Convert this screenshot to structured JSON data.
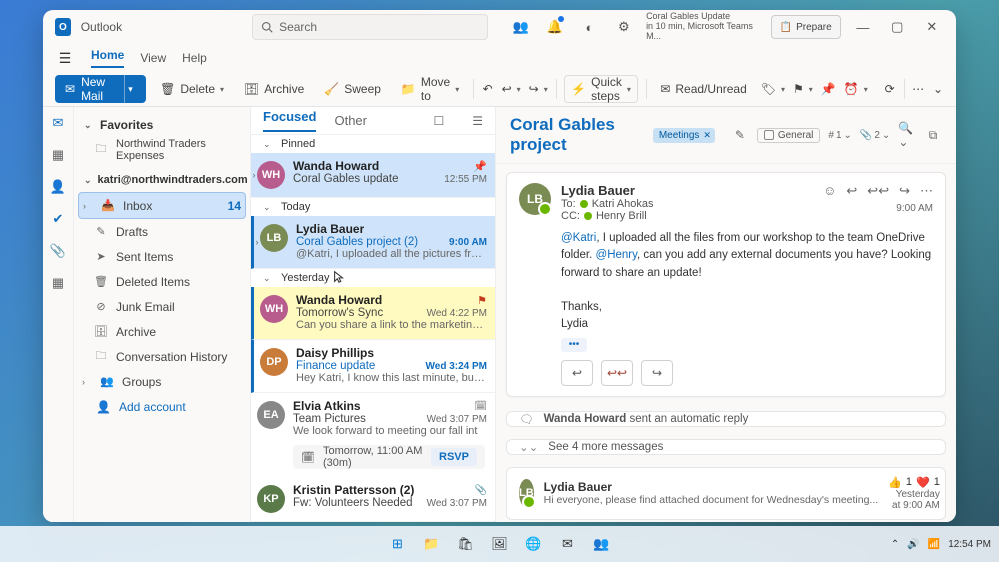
{
  "app": {
    "name": "Outlook"
  },
  "search": {
    "placeholder": "Search"
  },
  "reminder": {
    "title": "Coral Gables Update",
    "sub": "in 10 min, Microsoft Teams M..."
  },
  "prepare": {
    "label": "Prepare"
  },
  "menus": {
    "home": "Home",
    "view": "View",
    "help": "Help"
  },
  "ribbon": {
    "newmail": "New Mail",
    "delete": "Delete",
    "archive": "Archive",
    "sweep": "Sweep",
    "moveto": "Move to",
    "quicksteps": "Quick steps",
    "readunread": "Read/Unread"
  },
  "folders": {
    "favorites": "Favorites",
    "nt_expenses": "Northwind Traders Expenses",
    "account": "katri@northwindtraders.com",
    "inbox": "Inbox",
    "inbox_count": "14",
    "drafts": "Drafts",
    "sent": "Sent Items",
    "deleted": "Deleted Items",
    "junk": "Junk Email",
    "archive": "Archive",
    "convo": "Conversation History",
    "groups": "Groups",
    "addacct": "Add account"
  },
  "tabs": {
    "focused": "Focused",
    "other": "Other"
  },
  "groups": {
    "pinned": "Pinned",
    "today": "Today",
    "yesterday": "Yesterday"
  },
  "msgs": {
    "m1": {
      "sender": "Wanda Howard",
      "subject": "Coral Gables update",
      "date": "12:55 PM",
      "initials": "WH"
    },
    "m2": {
      "sender": "Lydia Bauer",
      "subject": "Coral Gables project  (2)",
      "date": "9:00 AM",
      "preview": "@Katri, I uploaded all the pictures from o",
      "initials": "LB"
    },
    "m3": {
      "sender": "Wanda Howard",
      "subject": "Tomorrow's Sync",
      "date": "Wed 4:22 PM",
      "preview": "Can you share a link to the marketing do",
      "initials": "WH"
    },
    "m4": {
      "sender": "Daisy Phillips",
      "subject": "Finance update",
      "date": "Wed 3:24 PM",
      "preview": "Hey Katri, I know this last minute, but do y",
      "initials": "DP"
    },
    "m5": {
      "sender": "Elvia Atkins",
      "subject": "Team Pictures",
      "date": "Wed 3:07 PM",
      "preview": "We look forward to meeting our fall int",
      "initials": "EA"
    },
    "m5_event": "Tomorrow, 11:00 AM (30m)",
    "m5_rsvp": "RSVP",
    "m6": {
      "sender": "Kristin Pattersson (2)",
      "subject": "Fw: Volunteers Needed",
      "date": "Wed 3:07 PM",
      "initials": "KP"
    }
  },
  "reading": {
    "title": "Coral Gables project",
    "tag": "Meetings",
    "category": "General",
    "count1": "1",
    "attach": "2",
    "from": "Lydia Bauer",
    "from_initials": "LB",
    "to_label": "To:",
    "to_name": "Katri Ahokas",
    "cc_label": "CC:",
    "cc_name": "Henry Brill",
    "time": "9:00 AM",
    "body_pre": ", I uploaded all the files from our workshop to the team OneDrive folder. ",
    "body_post": ", can you add any external documents you have? Looking forward to share an update!",
    "mention1": "@Katri",
    "mention2": "@Henry",
    "thanks": "Thanks,",
    "sig": "Lydia",
    "autoreply_name": "Wanda Howard",
    "autoreply_text": " sent an automatic reply",
    "seemore": "See 4 more messages",
    "c2_name": "Lydia Bauer",
    "c2_initials": "LB",
    "c2_prev": "Hi everyone, please find attached document for Wednesday's meeting...",
    "c2_time": "Yesterday at 9:00 AM",
    "r1": "1",
    "r2": "1"
  },
  "taskbar": {
    "time": "12:54 PM"
  }
}
